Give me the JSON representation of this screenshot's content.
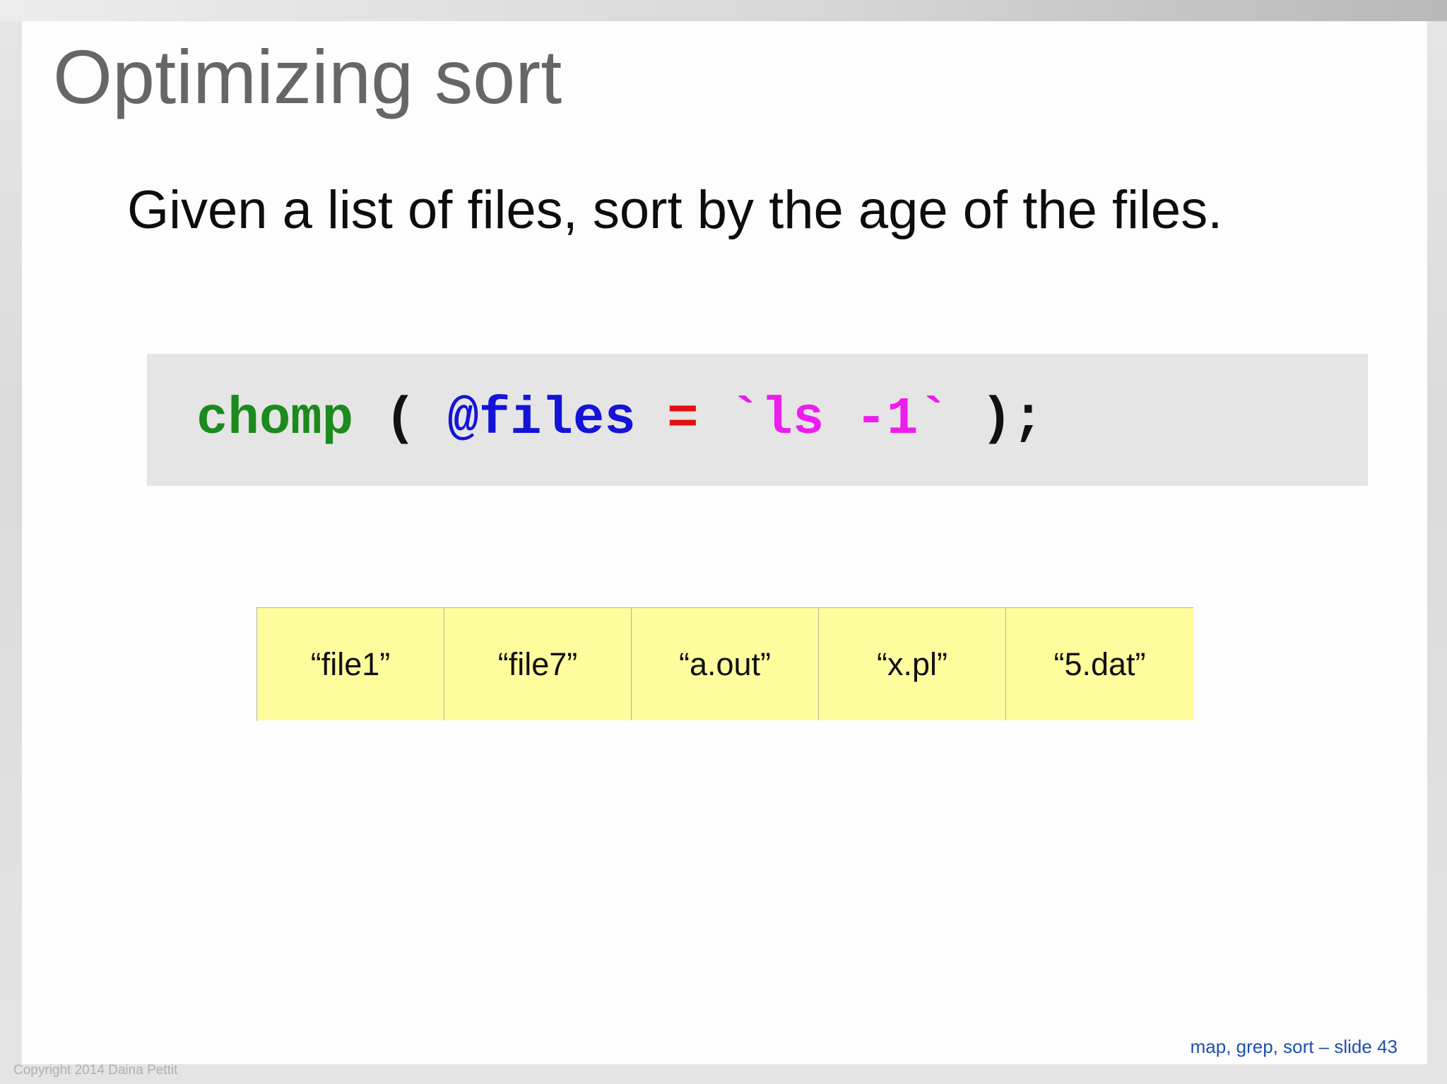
{
  "slide": {
    "title": "Optimizing sort",
    "subtitle": "Given a list of files, sort by the age of the files.",
    "code": {
      "function": "chomp",
      "open_paren": "( ",
      "variable": "@files",
      "operator": "=",
      "command": "`ls -1`",
      "close": " );"
    },
    "array_cells": [
      "“file1”",
      "“file7”",
      "“a.out”",
      "“x.pl”",
      "“5.dat”"
    ],
    "slide_label": "map, grep, sort – slide 43",
    "copyright": "Copyright 2014 Daina Pettit"
  },
  "colors": {
    "function": "#1c8a1c",
    "variable": "#1414d8",
    "operator": "#e60f0f",
    "command": "#ee1cec",
    "cell_background": "#fdfd9d",
    "code_background": "#e5e5e5",
    "title": "#666666",
    "slide_label": "#1f4fae"
  }
}
